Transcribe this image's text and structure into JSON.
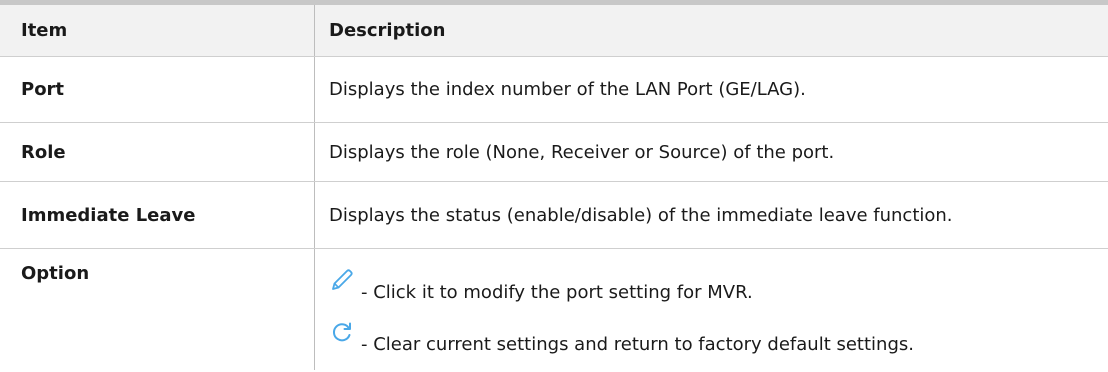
{
  "table": {
    "header": {
      "item": "Item",
      "description": "Description"
    },
    "rows": [
      {
        "item": "Port",
        "description": "Displays the index number of the LAN Port (GE/LAG)."
      },
      {
        "item": "Role",
        "description": "Displays the role (None, Receiver or Source) of the port."
      },
      {
        "item": "Immediate Leave",
        "description": "Displays the status (enable/disable) of the immediate leave function."
      },
      {
        "item": "Option",
        "options": [
          {
            "icon": "pencil-icon",
            "text": "- Click it to modify the port setting for MVR."
          },
          {
            "icon": "refresh-icon",
            "text": "- Clear current settings and return to factory default settings."
          }
        ]
      }
    ]
  },
  "colors": {
    "icon_accent": "#4aa8e8",
    "header_bg": "#f2f2f2",
    "top_rule": "#c8c8c8"
  }
}
